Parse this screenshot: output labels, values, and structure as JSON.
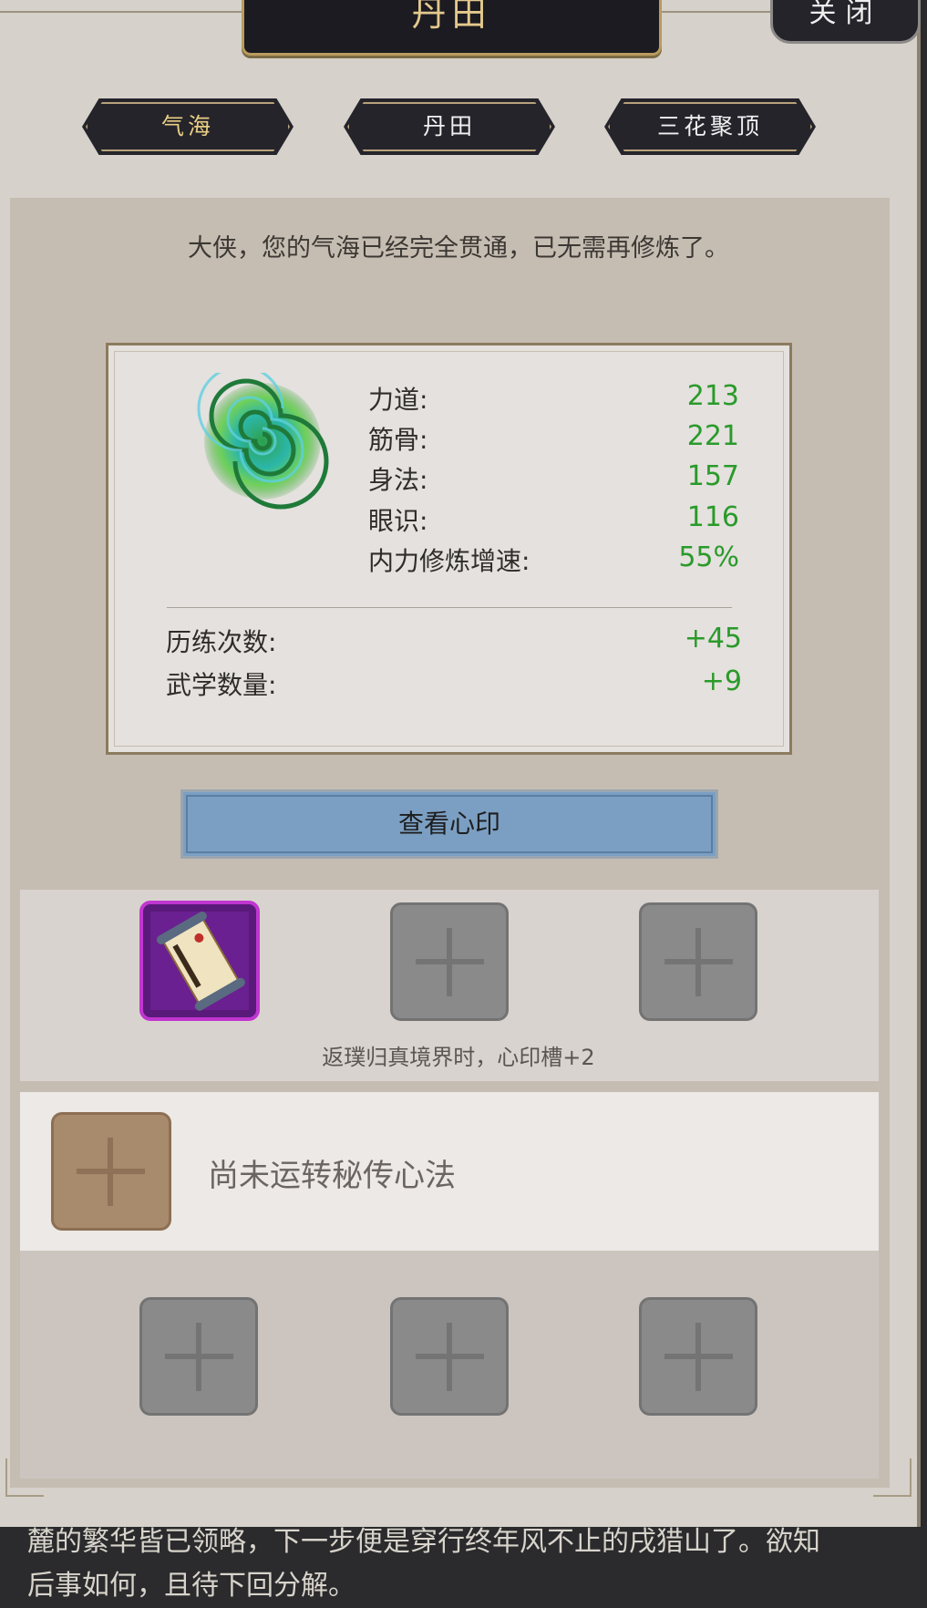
{
  "header": {
    "title": "丹田",
    "close_label": "关闭"
  },
  "tabs": [
    {
      "label": "气海",
      "active": true
    },
    {
      "label": "丹田",
      "active": false
    },
    {
      "label": "三花聚顶",
      "active": false
    }
  ],
  "message": "大侠，您的气海已经完全贯通，已无需再修炼了。",
  "stats": {
    "icon": "qi-vortex-icon",
    "attributes": [
      {
        "label": "力道:",
        "value": "213"
      },
      {
        "label": "筋骨:",
        "value": "221"
      },
      {
        "label": "身法:",
        "value": "157"
      },
      {
        "label": "眼识:",
        "value": "116"
      },
      {
        "label": "内力修炼增速:",
        "value": "55%"
      }
    ],
    "bonuses": [
      {
        "label": "历练次数:",
        "value": "+45"
      },
      {
        "label": "武学数量:",
        "value": "+9"
      }
    ]
  },
  "view_button_label": "查看心印",
  "heart_seal": {
    "filled_slot_icon": "scroll-icon",
    "note": "返璞归真境界时，心印槽+2"
  },
  "secret_method": {
    "empty_text": "尚未运转秘传心法"
  },
  "story_text": [
    "麓的繁华皆已领略，下一步便是穿行终年风不止的戌猎山了。欲知",
    "后事如何，且待下回分解。"
  ],
  "colors": {
    "value_green": "#2a9a2a",
    "tab_active": "#e8cf84",
    "button_blue": "#7b9fc2",
    "rare_purple": "#c036d0"
  }
}
